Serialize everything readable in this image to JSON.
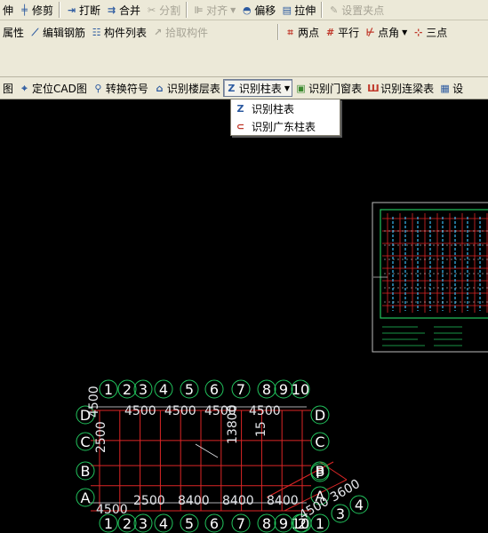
{
  "toolbar1": {
    "items": [
      {
        "label": "伸",
        "icon": "stretch-icon",
        "enabled": true
      },
      {
        "label": "修剪",
        "icon": "trim-icon",
        "enabled": true
      },
      {
        "label": "打断",
        "icon": "break-icon",
        "enabled": true
      },
      {
        "label": "合并",
        "icon": "merge-icon",
        "enabled": true
      },
      {
        "label": "分割",
        "icon": "split-icon",
        "enabled": false
      },
      {
        "label": "对齐",
        "icon": "align-icon",
        "enabled": false
      },
      {
        "label": "偏移",
        "icon": "offset-icon",
        "enabled": true
      },
      {
        "label": "拉伸",
        "icon": "pull-icon",
        "enabled": true
      },
      {
        "label": "设置夹点",
        "icon": "grip-icon",
        "enabled": false
      }
    ]
  },
  "toolbar2": {
    "left": [
      {
        "label": "属性",
        "icon": "",
        "enabled": true
      },
      {
        "label": "编辑钢筋",
        "icon": "rebar-icon",
        "enabled": true
      },
      {
        "label": "构件列表",
        "icon": "list-icon",
        "enabled": true
      },
      {
        "label": "拾取构件",
        "icon": "pick-icon",
        "enabled": false
      }
    ],
    "right": [
      {
        "label": "两点",
        "icon": "two-point-icon"
      },
      {
        "label": "平行",
        "icon": "parallel-icon"
      },
      {
        "label": "点角",
        "icon": "point-angle-icon"
      },
      {
        "label": "三点",
        "icon": "three-point-icon"
      }
    ]
  },
  "toolbar3": {
    "items": [
      {
        "label": "图",
        "icon": ""
      },
      {
        "label": "定位CAD图",
        "icon": "locate-cad-icon"
      },
      {
        "label": "转换符号",
        "icon": "convert-symbol-icon"
      },
      {
        "label": "识别楼层表",
        "icon": "floor-table-icon"
      },
      {
        "label": "识别柱表",
        "icon": "column-table-icon"
      },
      {
        "label": "识别门窗表",
        "icon": "door-window-icon"
      },
      {
        "label": "识别连梁表",
        "icon": "coupling-beam-icon"
      },
      {
        "label": "设",
        "icon": "settings-icon"
      }
    ]
  },
  "dropdown": {
    "items": [
      {
        "label": "识别柱表",
        "icon": "column-table-icon"
      },
      {
        "label": "识别广东柱表",
        "icon": "guangdong-column-icon"
      }
    ]
  },
  "cad": {
    "col_axes_top": [
      "1",
      "2",
      "3",
      "4",
      "5",
      "6",
      "7",
      "8",
      "9",
      "10"
    ],
    "col_axes_bottom": [
      "1",
      "2",
      "3",
      "4",
      "5",
      "6",
      "7",
      "8",
      "9",
      "10",
      "1",
      "2",
      "3",
      "4"
    ],
    "row_axes": [
      "D",
      "C",
      "B",
      "A"
    ],
    "right_axes": [
      "D",
      "C",
      "B",
      "A",
      "P"
    ],
    "dims": [
      "4500",
      "4500",
      "4500",
      "4500",
      "4500",
      "2500",
      "13800",
      "15",
      "8400",
      "8400",
      "8400",
      "2500",
      "4500",
      "4500",
      "3600"
    ]
  },
  "colors": {
    "toolbar_bg": "#ece9d8",
    "canvas_bg": "#000000",
    "axis_green": "#22c55e",
    "grid_red": "#dc2626",
    "dim_white": "#e5e7eb"
  }
}
